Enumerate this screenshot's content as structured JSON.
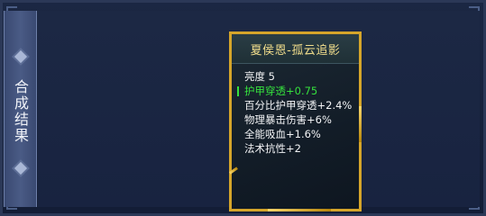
{
  "panel": {
    "side_title": "合成结果"
  },
  "item": {
    "name": "夏侯恩-孤云追影",
    "attributes": [
      {
        "text": "亮度 5",
        "highlight": false
      },
      {
        "text": "护甲穿透+0.75",
        "highlight": true
      },
      {
        "text": "百分比护甲穿透+2.4%",
        "highlight": false
      },
      {
        "text": "物理暴击伤害+6%",
        "highlight": false
      },
      {
        "text": "全能吸血+1.6%",
        "highlight": false
      },
      {
        "text": "法术抗性+2",
        "highlight": false
      }
    ]
  },
  "colors": {
    "title_gold": "#f2de8c",
    "highlight_green": "#35e03d",
    "card_border": "#d5a52a",
    "background": "#1b2743"
  }
}
